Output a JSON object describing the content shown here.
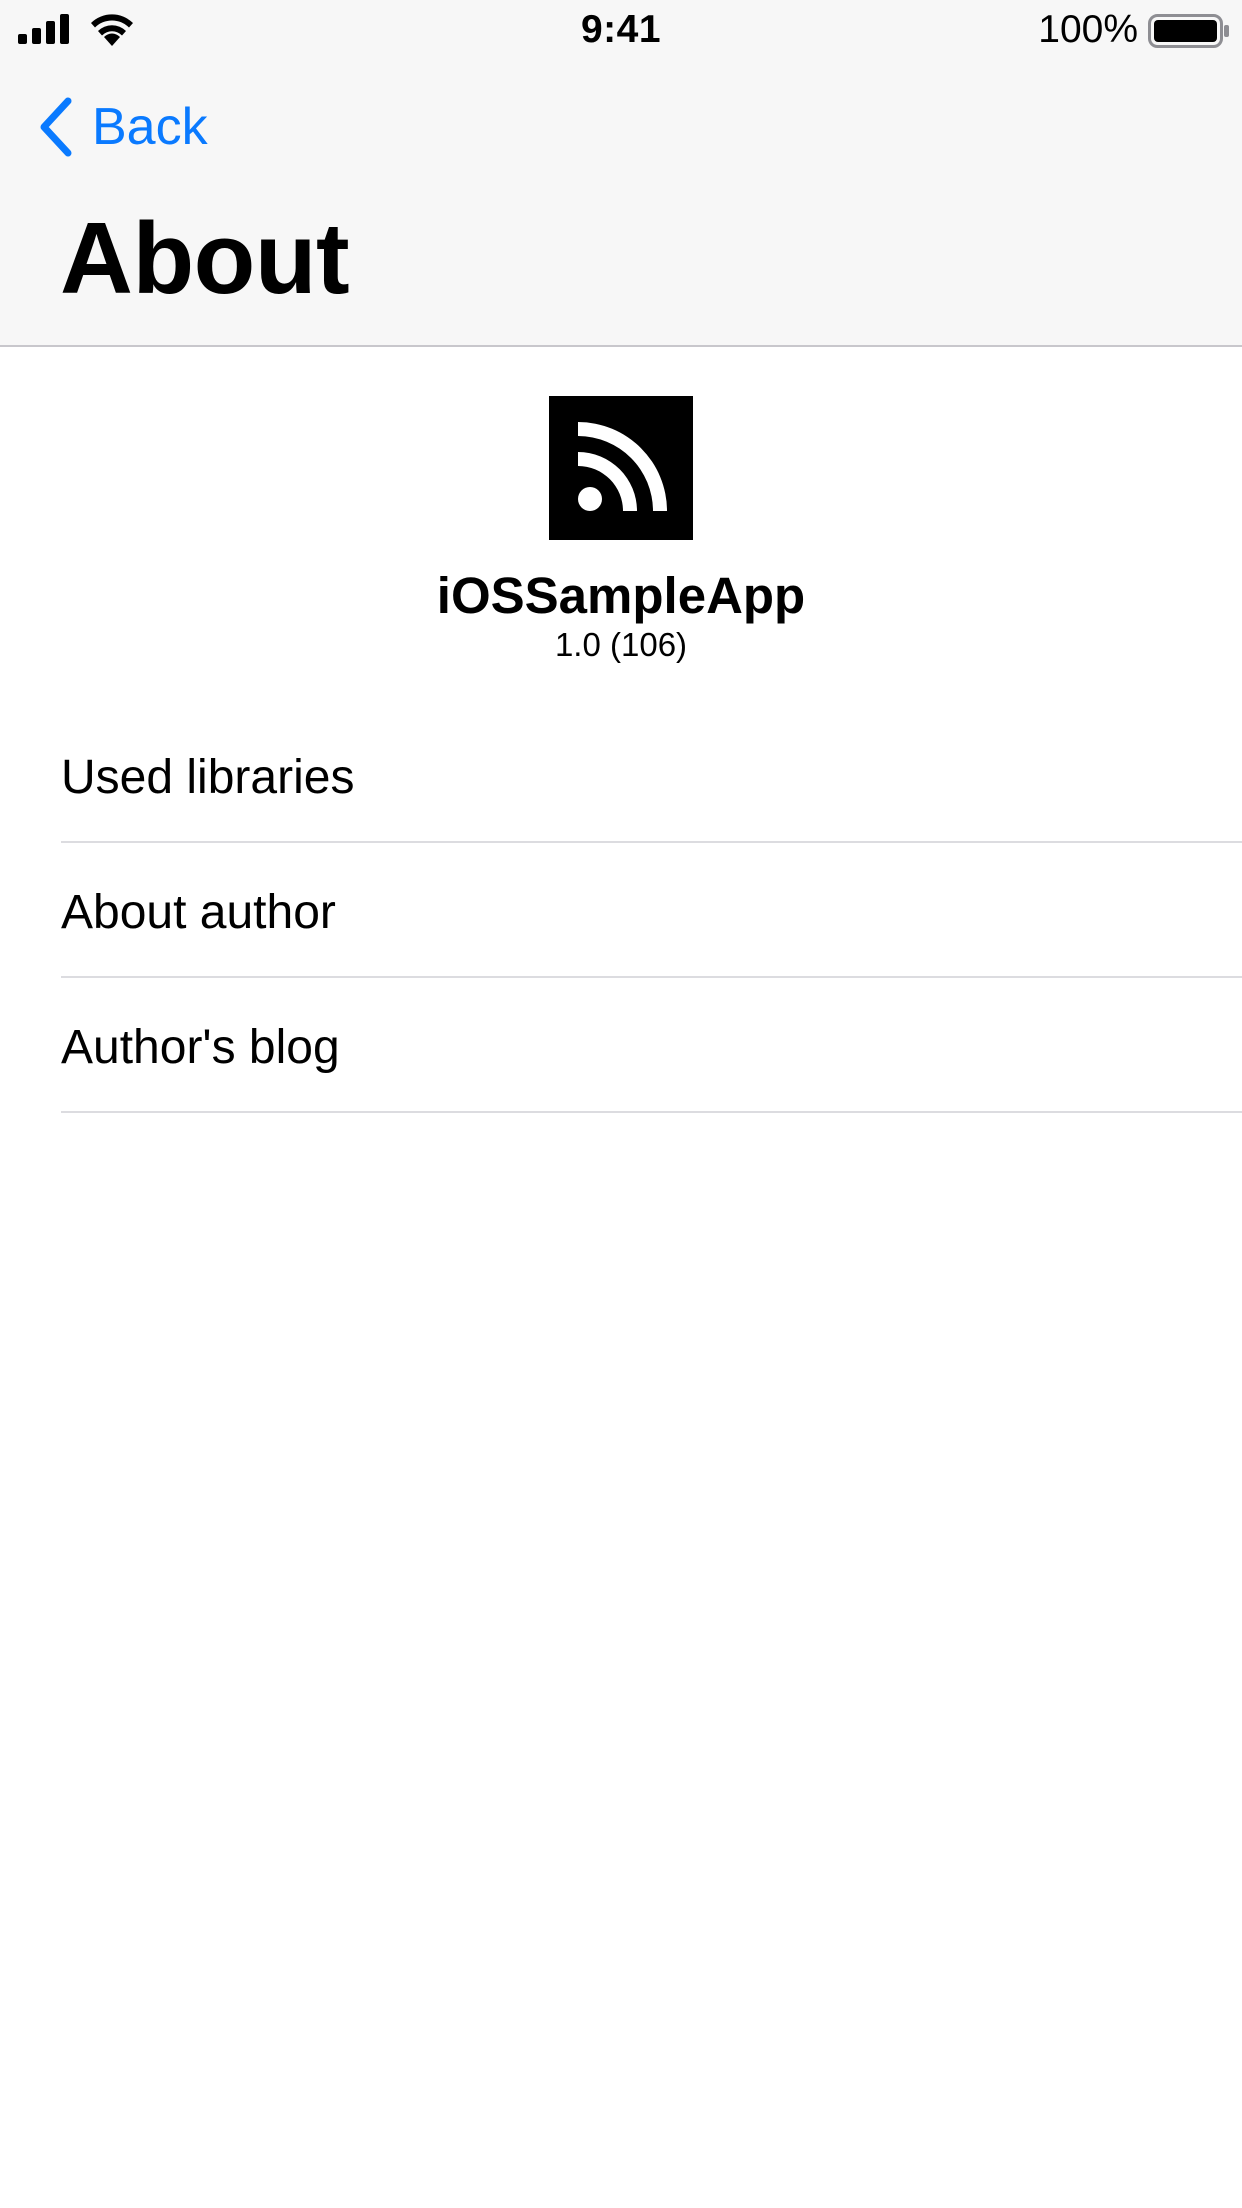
{
  "status_bar": {
    "time": "9:41",
    "battery_percent": "100%",
    "signal_icon": "cellular-signal-icon",
    "wifi_icon": "wifi-icon",
    "battery_icon": "battery-full-icon"
  },
  "nav": {
    "back_label": "Back",
    "back_icon": "chevron-left-icon",
    "title": "About"
  },
  "app": {
    "icon": "rss-feed-icon",
    "name": "iOSSampleApp",
    "version": "1.0 (106)"
  },
  "menu": {
    "items": [
      {
        "label": "Used libraries"
      },
      {
        "label": "About author"
      },
      {
        "label": "Author's blog"
      }
    ]
  },
  "colors": {
    "accent": "#0a7aff",
    "bar_background": "#f7f7f7",
    "separator": "#dcdce0"
  }
}
